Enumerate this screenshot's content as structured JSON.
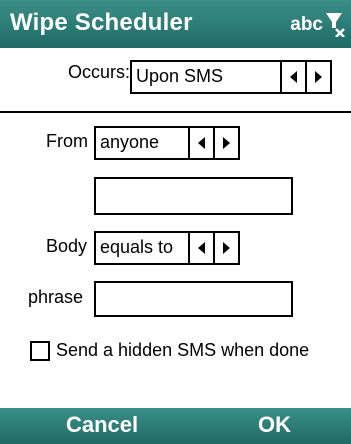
{
  "window": {
    "title": "Wipe Scheduler",
    "input_mode": "abc",
    "input_icon": "funnel-icon"
  },
  "occurs": {
    "label": "Occurs:",
    "value": "Upon SMS"
  },
  "from": {
    "label": "From",
    "value": "anyone",
    "text_value": ""
  },
  "body": {
    "label": "Body",
    "value": "equals to"
  },
  "phrase": {
    "label": "phrase",
    "value": ""
  },
  "hidden_sms": {
    "label": "Send a hidden SMS when done",
    "checked": false
  },
  "softkeys": {
    "left": "Cancel",
    "right": "OK"
  },
  "colors": {
    "bar": "#2a7c76",
    "text_on_bar": "#ffffff"
  }
}
